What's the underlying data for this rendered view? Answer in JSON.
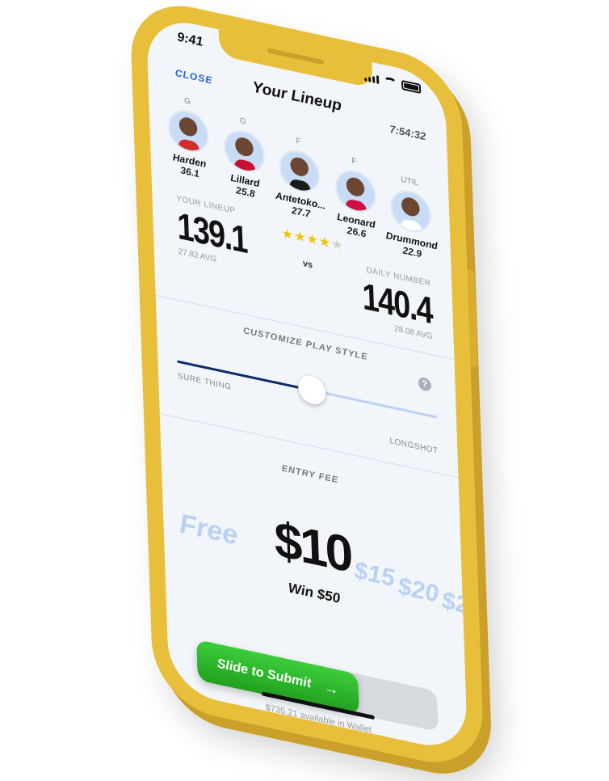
{
  "status": {
    "time": "9:41"
  },
  "header": {
    "close_label": "CLOSE",
    "title": "Your Lineup",
    "timer": "7:54:32"
  },
  "players": [
    {
      "position": "G",
      "name": "Harden",
      "score": "36.1",
      "jersey": "#d42b2b"
    },
    {
      "position": "G",
      "name": "Lillard",
      "score": "25.8",
      "jersey": "#c8102e"
    },
    {
      "position": "F",
      "name": "Antetoko...",
      "score": "27.7",
      "jersey": "#1a1a1a"
    },
    {
      "position": "F",
      "name": "Leonard",
      "score": "26.6",
      "jersey": "#ce1141"
    },
    {
      "position": "UTIL",
      "name": "Drummond",
      "score": "22.9",
      "jersey": "#ffffff"
    }
  ],
  "comparison": {
    "your_label": "YOUR LINEUP",
    "your_total": "139.1",
    "your_avg": "27.82 AVG",
    "vs_label": "vs",
    "daily_label": "DAILY NUMBER",
    "daily_total": "140.4",
    "daily_avg": "28.08 AVG",
    "stars_full": "★★★★",
    "stars_half": "★",
    "rating": 4.5
  },
  "play_style": {
    "title": "CUSTOMIZE PLAY STYLE",
    "help_label": "?",
    "left_label": "SURE THING",
    "right_label": "LONGSHOT",
    "value": 0.52
  },
  "entry_fee": {
    "title": "ENTRY FEE",
    "options": [
      "Free",
      "$15",
      "$20",
      "$2"
    ],
    "selected": "$10",
    "win_label": "Win $50"
  },
  "submit": {
    "label": "Slide to Submit",
    "arrow": "→",
    "wallet_text": "$735.21 available in Wallet"
  },
  "colors": {
    "phone": "#E8BF3A",
    "accent_blue": "#1d63e0",
    "submit_green": "#2db52a"
  }
}
